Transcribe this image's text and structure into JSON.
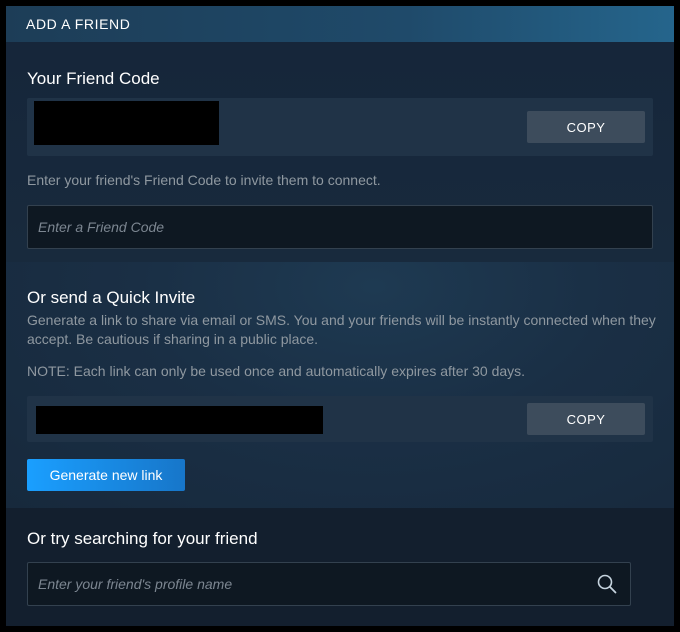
{
  "header": {
    "title": "ADD A FRIEND"
  },
  "friend_code": {
    "title": "Your Friend Code",
    "copy_label": "COPY",
    "instructions": "Enter your friend's Friend Code to invite them to connect.",
    "input_placeholder": "Enter a Friend Code"
  },
  "quick_invite": {
    "title": "Or send a Quick Invite",
    "description": "Generate a link to share via email or SMS. You and your friends will be instantly connected when they accept. Be cautious if sharing in a public place.",
    "note": "NOTE: Each link can only be used once and automatically expires after 30 days.",
    "copy_label": "COPY",
    "generate_label": "Generate new link"
  },
  "search": {
    "title": "Or try searching for your friend",
    "input_placeholder": "Enter your friend's profile name",
    "icon": "search-icon"
  },
  "colors": {
    "background": "#1b2838",
    "accent": "#1a9fff",
    "text_primary": "#ffffff",
    "text_muted": "#8f98a0"
  }
}
